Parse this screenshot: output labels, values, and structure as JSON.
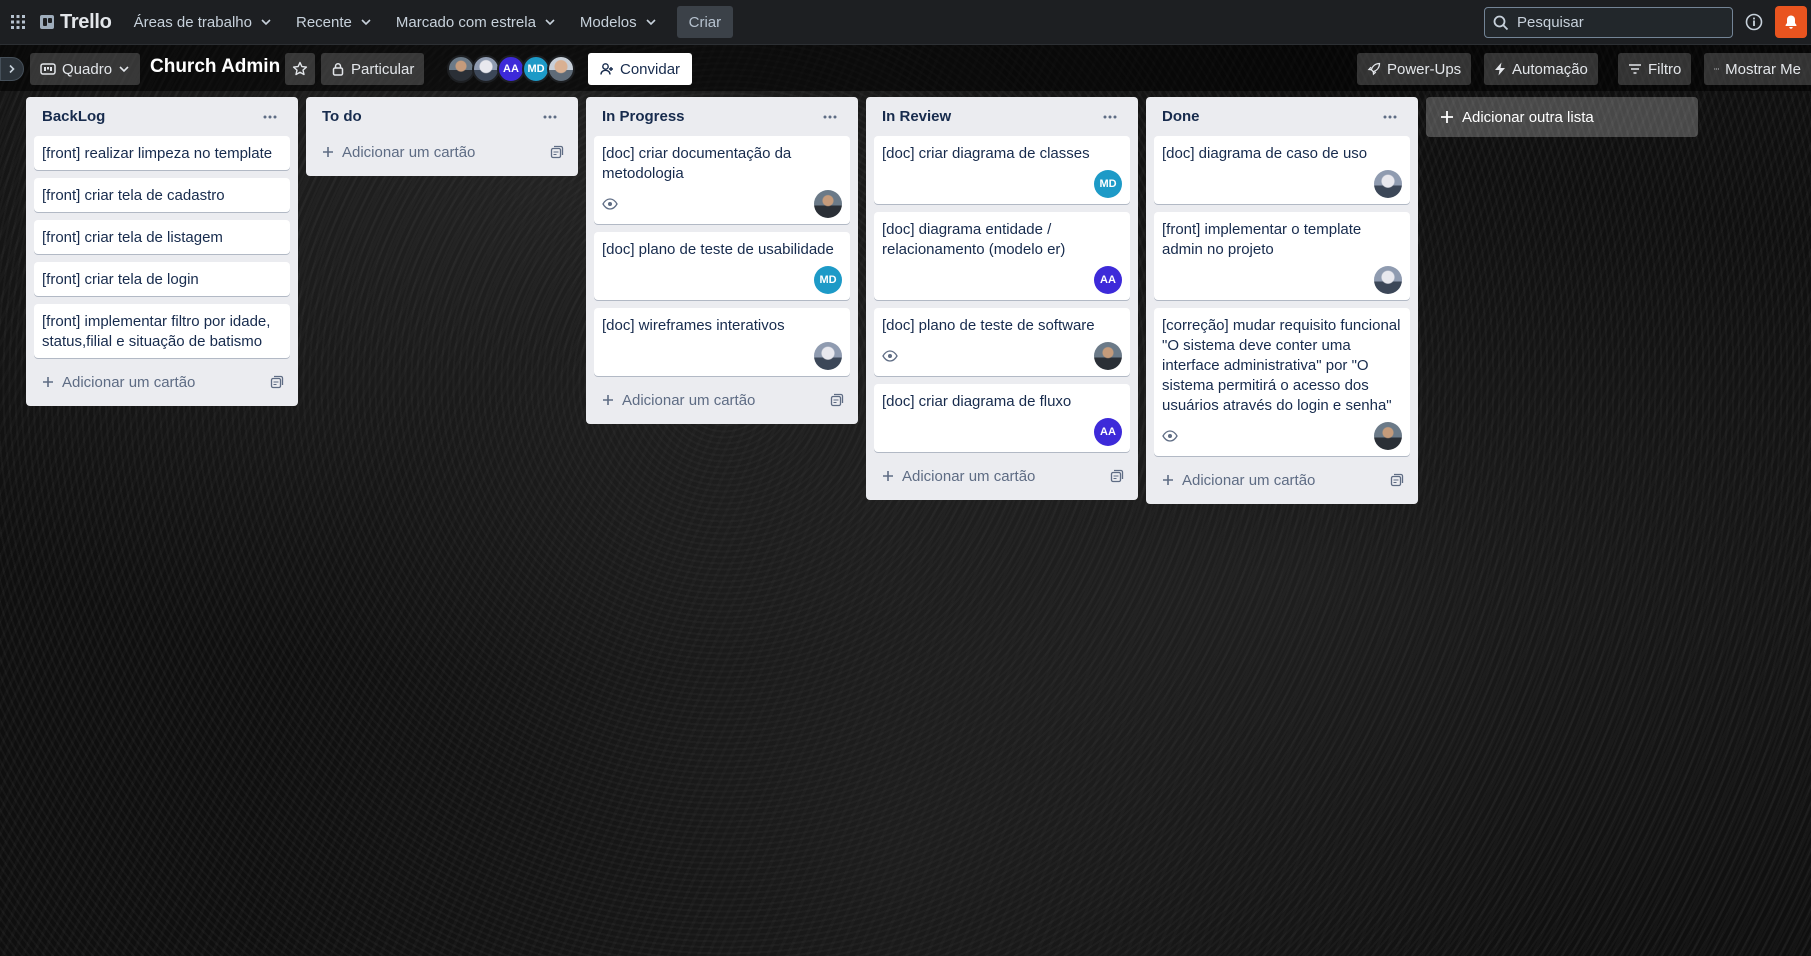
{
  "header": {
    "logo": "Trello",
    "nav": [
      {
        "label": "Áreas de trabalho"
      },
      {
        "label": "Recente"
      },
      {
        "label": "Marcado com estrela"
      },
      {
        "label": "Modelos"
      }
    ],
    "create_label": "Criar",
    "search_placeholder": "Pesquisar"
  },
  "board": {
    "view_label": "Quadro",
    "title": "Church Admin",
    "visibility_label": "Particular",
    "members": [
      {
        "type": "photo"
      },
      {
        "type": "photo"
      },
      {
        "type": "initials",
        "initials": "AA",
        "color": "#3d2ad9"
      },
      {
        "type": "initials",
        "initials": "MD",
        "color": "#1d9ac7"
      },
      {
        "type": "photo"
      }
    ],
    "invite_label": "Convidar",
    "powerups_label": "Power-Ups",
    "automation_label": "Automação",
    "filter_label": "Filtro",
    "show_menu_label": "Mostrar Me"
  },
  "lists": [
    {
      "title": "BackLog",
      "cards": [
        {
          "title": "[front] realizar limpeza no template"
        },
        {
          "title": "[front] criar tela de cadastro"
        },
        {
          "title": "[front] criar tela de listagem"
        },
        {
          "title": "[front] criar tela de login"
        },
        {
          "title": "[front] implementar filtro por idade, status,filial e situação de batismo"
        }
      ],
      "add_card_label": "Adicionar um cartão"
    },
    {
      "title": "To do",
      "cards": [],
      "add_card_label": "Adicionar um cartão"
    },
    {
      "title": "In Progress",
      "cards": [
        {
          "title": "[doc] criar documentação da metodologia",
          "watch": true,
          "member": "photo-a"
        },
        {
          "title": "[doc] plano de teste de usabilidade",
          "member": "MD"
        },
        {
          "title": "[doc] wireframes interativos",
          "member": "photo-b"
        }
      ],
      "add_card_label": "Adicionar um cartão"
    },
    {
      "title": "In Review",
      "cards": [
        {
          "title": "[doc] criar diagrama de classes",
          "member": "MD"
        },
        {
          "title": "[doc] diagrama entidade / relacionamento (modelo er)",
          "member": "AA"
        },
        {
          "title": "[doc] plano de teste de software",
          "watch": true,
          "member": "photo-a"
        },
        {
          "title": "[doc] criar diagrama de fluxo",
          "member": "AA"
        }
      ],
      "add_card_label": "Adicionar um cartão"
    },
    {
      "title": "Done",
      "cards": [
        {
          "title": "[doc] diagrama de caso de uso",
          "member": "photo-b"
        },
        {
          "title": "[front] implementar o template admin no projeto",
          "member": "photo-b"
        },
        {
          "title": "[correção] mudar requisito funcional \"O sistema deve conter uma interface administrativa\" por \"O sistema permitirá o acesso dos usuários através do login e senha\"",
          "watch": true,
          "member": "photo-a"
        }
      ],
      "add_card_label": "Adicionar um cartão"
    }
  ],
  "add_list_label": "Adicionar outra lista",
  "colors": {
    "AA": "#3d2ad9",
    "MD": "#1d9ac7",
    "notification": "#e9541f"
  }
}
